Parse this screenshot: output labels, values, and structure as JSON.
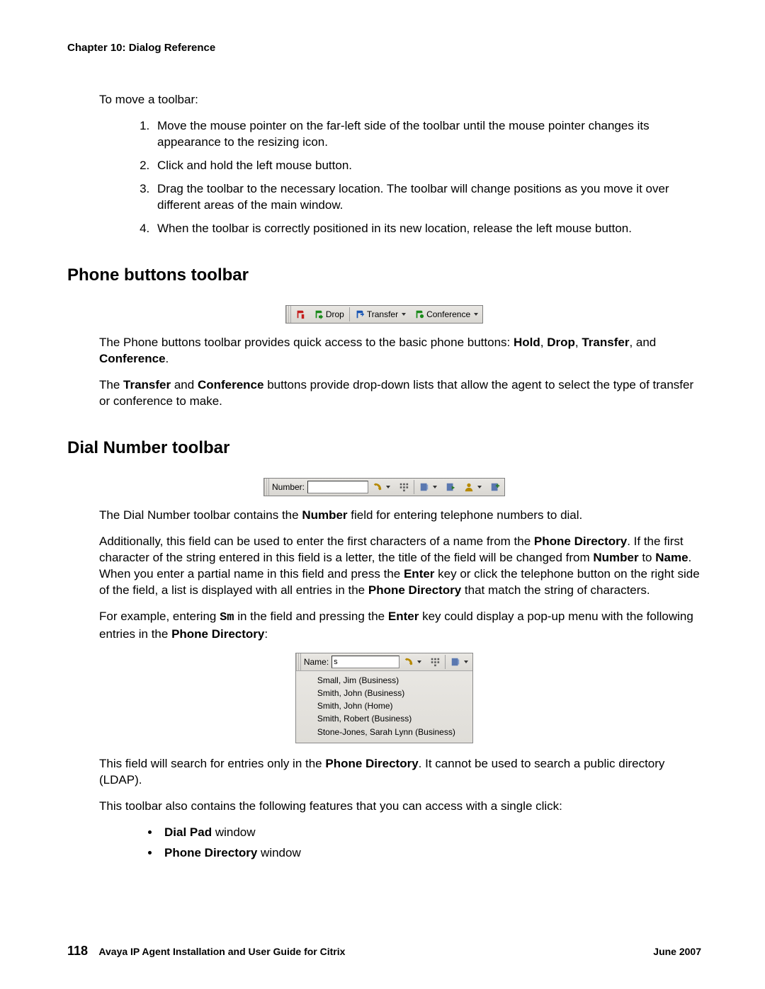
{
  "header": {
    "chapter": "Chapter 10: Dialog Reference"
  },
  "intro": "To move a toolbar:",
  "steps": [
    "Move the mouse pointer on the far-left side of the toolbar until the mouse pointer changes its appearance to the resizing icon.",
    "Click and hold the left mouse button.",
    "Drag the toolbar to the necessary location. The toolbar will change positions as you move it over different areas of the main window.",
    "When the toolbar is correctly positioned in its new location, release the left mouse button."
  ],
  "phone_section": {
    "heading": "Phone buttons toolbar",
    "toolbar": {
      "drop": "Drop",
      "transfer": "Transfer",
      "conference": "Conference"
    },
    "para1_pre": "The Phone buttons toolbar provides quick access to the basic phone buttons: ",
    "para1_b": [
      "Hold",
      "Drop",
      "Transfer",
      "Conference"
    ],
    "para1_joiners": [
      ", ",
      ", ",
      ", and "
    ],
    "para1_end": ".",
    "para2_pre": "The ",
    "para2_b1": "Transfer",
    "para2_mid1": " and ",
    "para2_b2": "Conference",
    "para2_end": " buttons provide drop-down lists that allow the agent to select the type of transfer or conference to make."
  },
  "dial_section": {
    "heading": "Dial Number toolbar",
    "toolbar": {
      "label": "Number:",
      "value": ""
    },
    "p1_pre": "The Dial Number toolbar contains the ",
    "p1_b1": "Number",
    "p1_end": " field for entering telephone numbers to dial.",
    "p2_a": "Additionally, this field can be used to enter the first characters of a name from the ",
    "p2_b1": "Phone Directory",
    "p2_c": ". If the first character of the string entered in this field is a letter, the title of the field will be changed from ",
    "p2_b2": "Number",
    "p2_d": " to ",
    "p2_b3": "Name",
    "p2_e": ". When you enter a partial name in this field and press the ",
    "p2_b4": "Enter",
    "p2_f": " key or click the telephone button on the right side of the field, a list is displayed with all entries in the ",
    "p2_b5": "Phone Directory",
    "p2_g": " that match the string of characters.",
    "p3_a": "For example, entering ",
    "p3_code": "Sm",
    "p3_b": " in the field and pressing the ",
    "p3_bold": "Enter",
    "p3_c": " key could display a pop-up menu with the following entries in the ",
    "p3_bold2": "Phone Directory",
    "p3_d": ":",
    "popup": {
      "label": "Name:",
      "value": "s",
      "entries": [
        "Small, Jim (Business)",
        "Smith, John (Business)",
        "Smith, John (Home)",
        "Smith, Robert (Business)",
        "Stone-Jones, Sarah Lynn (Business)"
      ]
    },
    "p4_a": "This field will search for entries only in the ",
    "p4_b": "Phone Directory",
    "p4_c": ". It cannot be used to search a public directory (LDAP).",
    "p5": "This toolbar also contains the following features that you can access with a single click:",
    "features": [
      {
        "bold": "Dial Pad",
        "rest": " window"
      },
      {
        "bold": "Phone Directory",
        "rest": " window"
      }
    ]
  },
  "footer": {
    "page": "118",
    "title": "Avaya IP Agent Installation and User Guide for Citrix",
    "date": "June 2007"
  }
}
